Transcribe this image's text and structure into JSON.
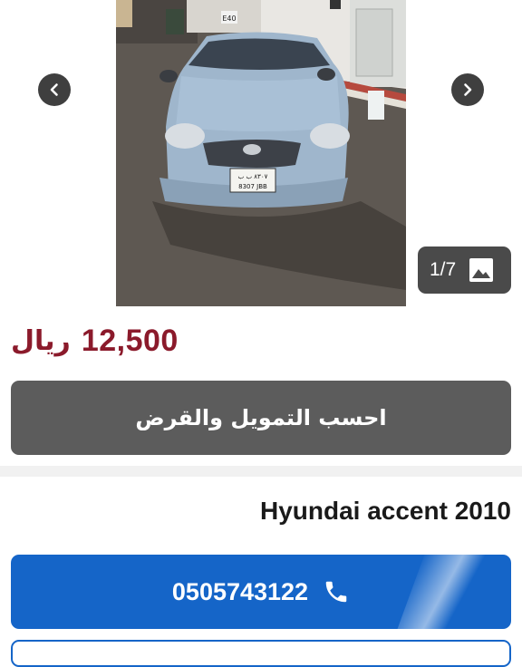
{
  "gallery": {
    "counter_text": "1/7",
    "current_index": 1,
    "total_images": 7,
    "icons": {
      "prev": "chevron-left-icon",
      "next": "chevron-right-icon",
      "counter": "image-icon"
    }
  },
  "listing": {
    "price_amount": "12,500",
    "price_currency": "ريال",
    "price_color": "#8b1a2b",
    "finance_button_label": "احسب التمويل والقرض",
    "car_title": "Hyundai accent 2010",
    "phone_number": "0505743122",
    "phone_icon": "phone-icon",
    "plate_text_top": "٨٣٠٧ ب ب",
    "plate_text_bottom": "8307 JBB",
    "truck_sign": "E40"
  },
  "colors": {
    "phone_button": "#1565c8",
    "finance_button": "#5c5c5c",
    "counter_badge": "#4a4a4a"
  }
}
